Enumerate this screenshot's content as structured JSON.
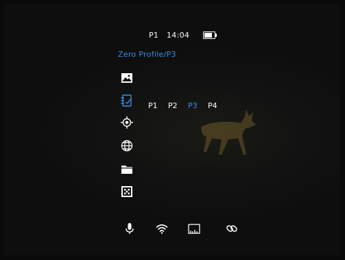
{
  "status_bar": {
    "profile": "P1",
    "time": "14:04",
    "battery_level": 0.8
  },
  "breadcrumb": "Zero Profile/P3",
  "menu": {
    "items": [
      {
        "icon": "image-icon"
      },
      {
        "icon": "zero-profile-icon"
      },
      {
        "icon": "crosshair-icon"
      },
      {
        "icon": "globe-icon"
      },
      {
        "icon": "folder-icon"
      },
      {
        "icon": "pixel-grid-icon"
      }
    ],
    "profile_options": [
      "P1",
      "P2",
      "P3",
      "P4"
    ],
    "selected_profile": "P3"
  },
  "bottom_bar": {
    "icons": [
      "microphone-icon",
      "wifi-icon",
      "ruler-icon",
      "link-icon"
    ]
  },
  "colors": {
    "accent": "#3a8fe0",
    "text": "#ffffff",
    "background": "#121212"
  }
}
